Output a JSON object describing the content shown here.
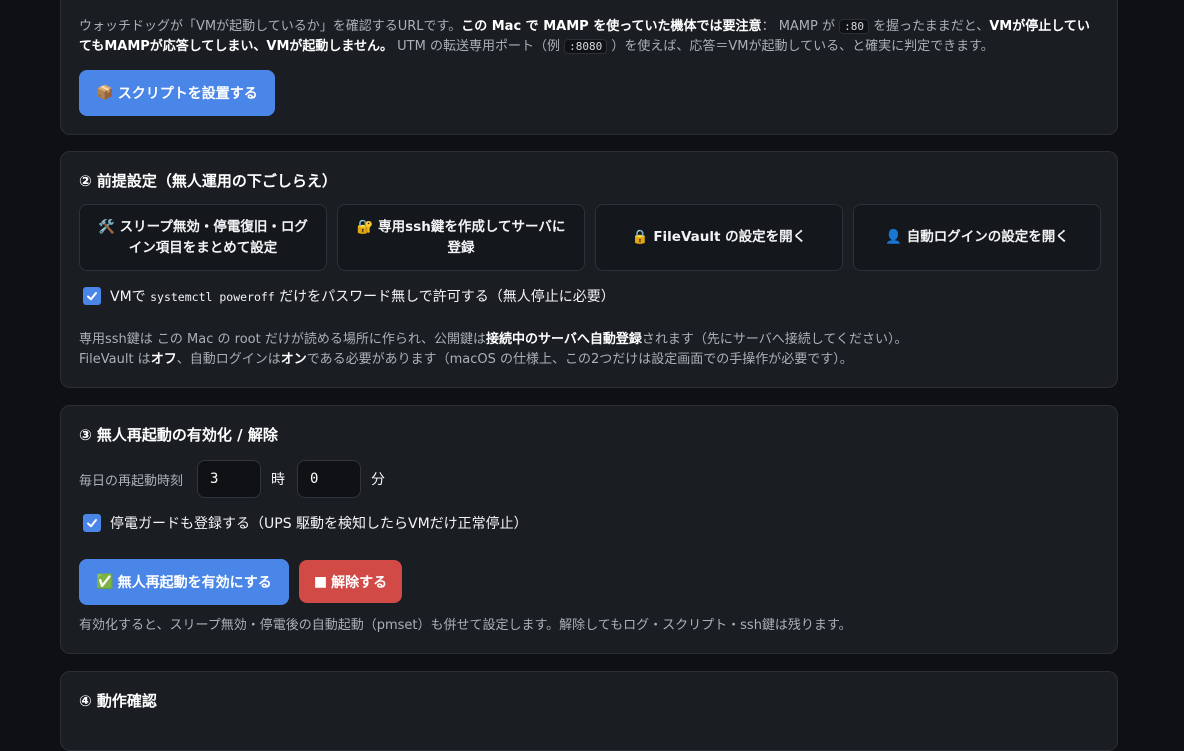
{
  "colors": {
    "accent": "#4a86e8",
    "danger": "#d14a46",
    "background": "#0e1014",
    "card": "#1a1d22"
  },
  "watchdog": {
    "note_parts": [
      {
        "t": "ウォッチドッグが「VMが起動しているか」を確認するURLです。"
      },
      {
        "t": "この Mac で MAMP を使っていた機体では要注意",
        "b": true
      },
      {
        "t": "： MAMP が "
      },
      {
        "t": ":80",
        "c": true
      },
      {
        "t": " を握ったままだと、"
      },
      {
        "t": "VMが停止していてもMAMPが応答してしまい、VMが起動しません。",
        "b": true
      },
      {
        "t": " UTM の転送専用ポート（例 "
      },
      {
        "t": ":8080",
        "c": true
      },
      {
        "t": " ）を使えば、応答＝VMが起動している、と確実に判定できます。"
      }
    ],
    "install_button": {
      "icon": "📦",
      "label": "スクリプトを設置する"
    }
  },
  "prereq": {
    "title": "② 前提設定（無人運用の下ごしらえ）",
    "tiles": [
      {
        "icon": "🛠️",
        "label": "スリープ無効・停電復旧・ログイン項目をまとめて設定"
      },
      {
        "icon": "🔐",
        "label": "専用ssh鍵を作成してサーバに登録"
      },
      {
        "icon": "🔒",
        "label": "FileVault の設定を開く"
      },
      {
        "icon": "👤",
        "label": "自動ログインの設定を開く"
      }
    ],
    "sudo_check": {
      "checked": true,
      "prefix": "VMで ",
      "code": "systemctl poweroff",
      "suffix": " だけをパスワード無しで許可する（無人停止に必要）"
    },
    "note_line1": [
      {
        "t": "専用ssh鍵は この Mac の root だけが読める場所に作られ、公開鍵は"
      },
      {
        "t": "接続中のサーバへ自動登録",
        "b": true
      },
      {
        "t": "されます（先にサーバへ接続してください）。"
      }
    ],
    "note_line2": [
      {
        "t": "FileVault は"
      },
      {
        "t": "オフ",
        "b": true
      },
      {
        "t": "、自動ログインは"
      },
      {
        "t": "オン",
        "b": true
      },
      {
        "t": "である必要があります（macOS の仕様上、この2つだけは設定画面での手操作が必要です）。"
      }
    ]
  },
  "reboot": {
    "title": "③ 無人再起動の有効化 / 解除",
    "time_label": "毎日の再起動時刻",
    "hour": "3",
    "hour_unit": "時",
    "minute": "0",
    "minute_unit": "分",
    "ups_check": {
      "checked": true,
      "label": "停電ガードも登録する（UPS 駆動を検知したらVMだけ正常停止）"
    },
    "enable_button": {
      "icon": "✅",
      "label": "無人再起動を有効にする"
    },
    "disable_button": {
      "icon": "■",
      "label": "解除する"
    },
    "note": "有効化すると、スリープ無効・停電後の自動起動（pmset）も併せて設定します。解除してもログ・スクリプト・ssh鍵は残ります。"
  },
  "verify": {
    "title": "④ 動作確認"
  }
}
